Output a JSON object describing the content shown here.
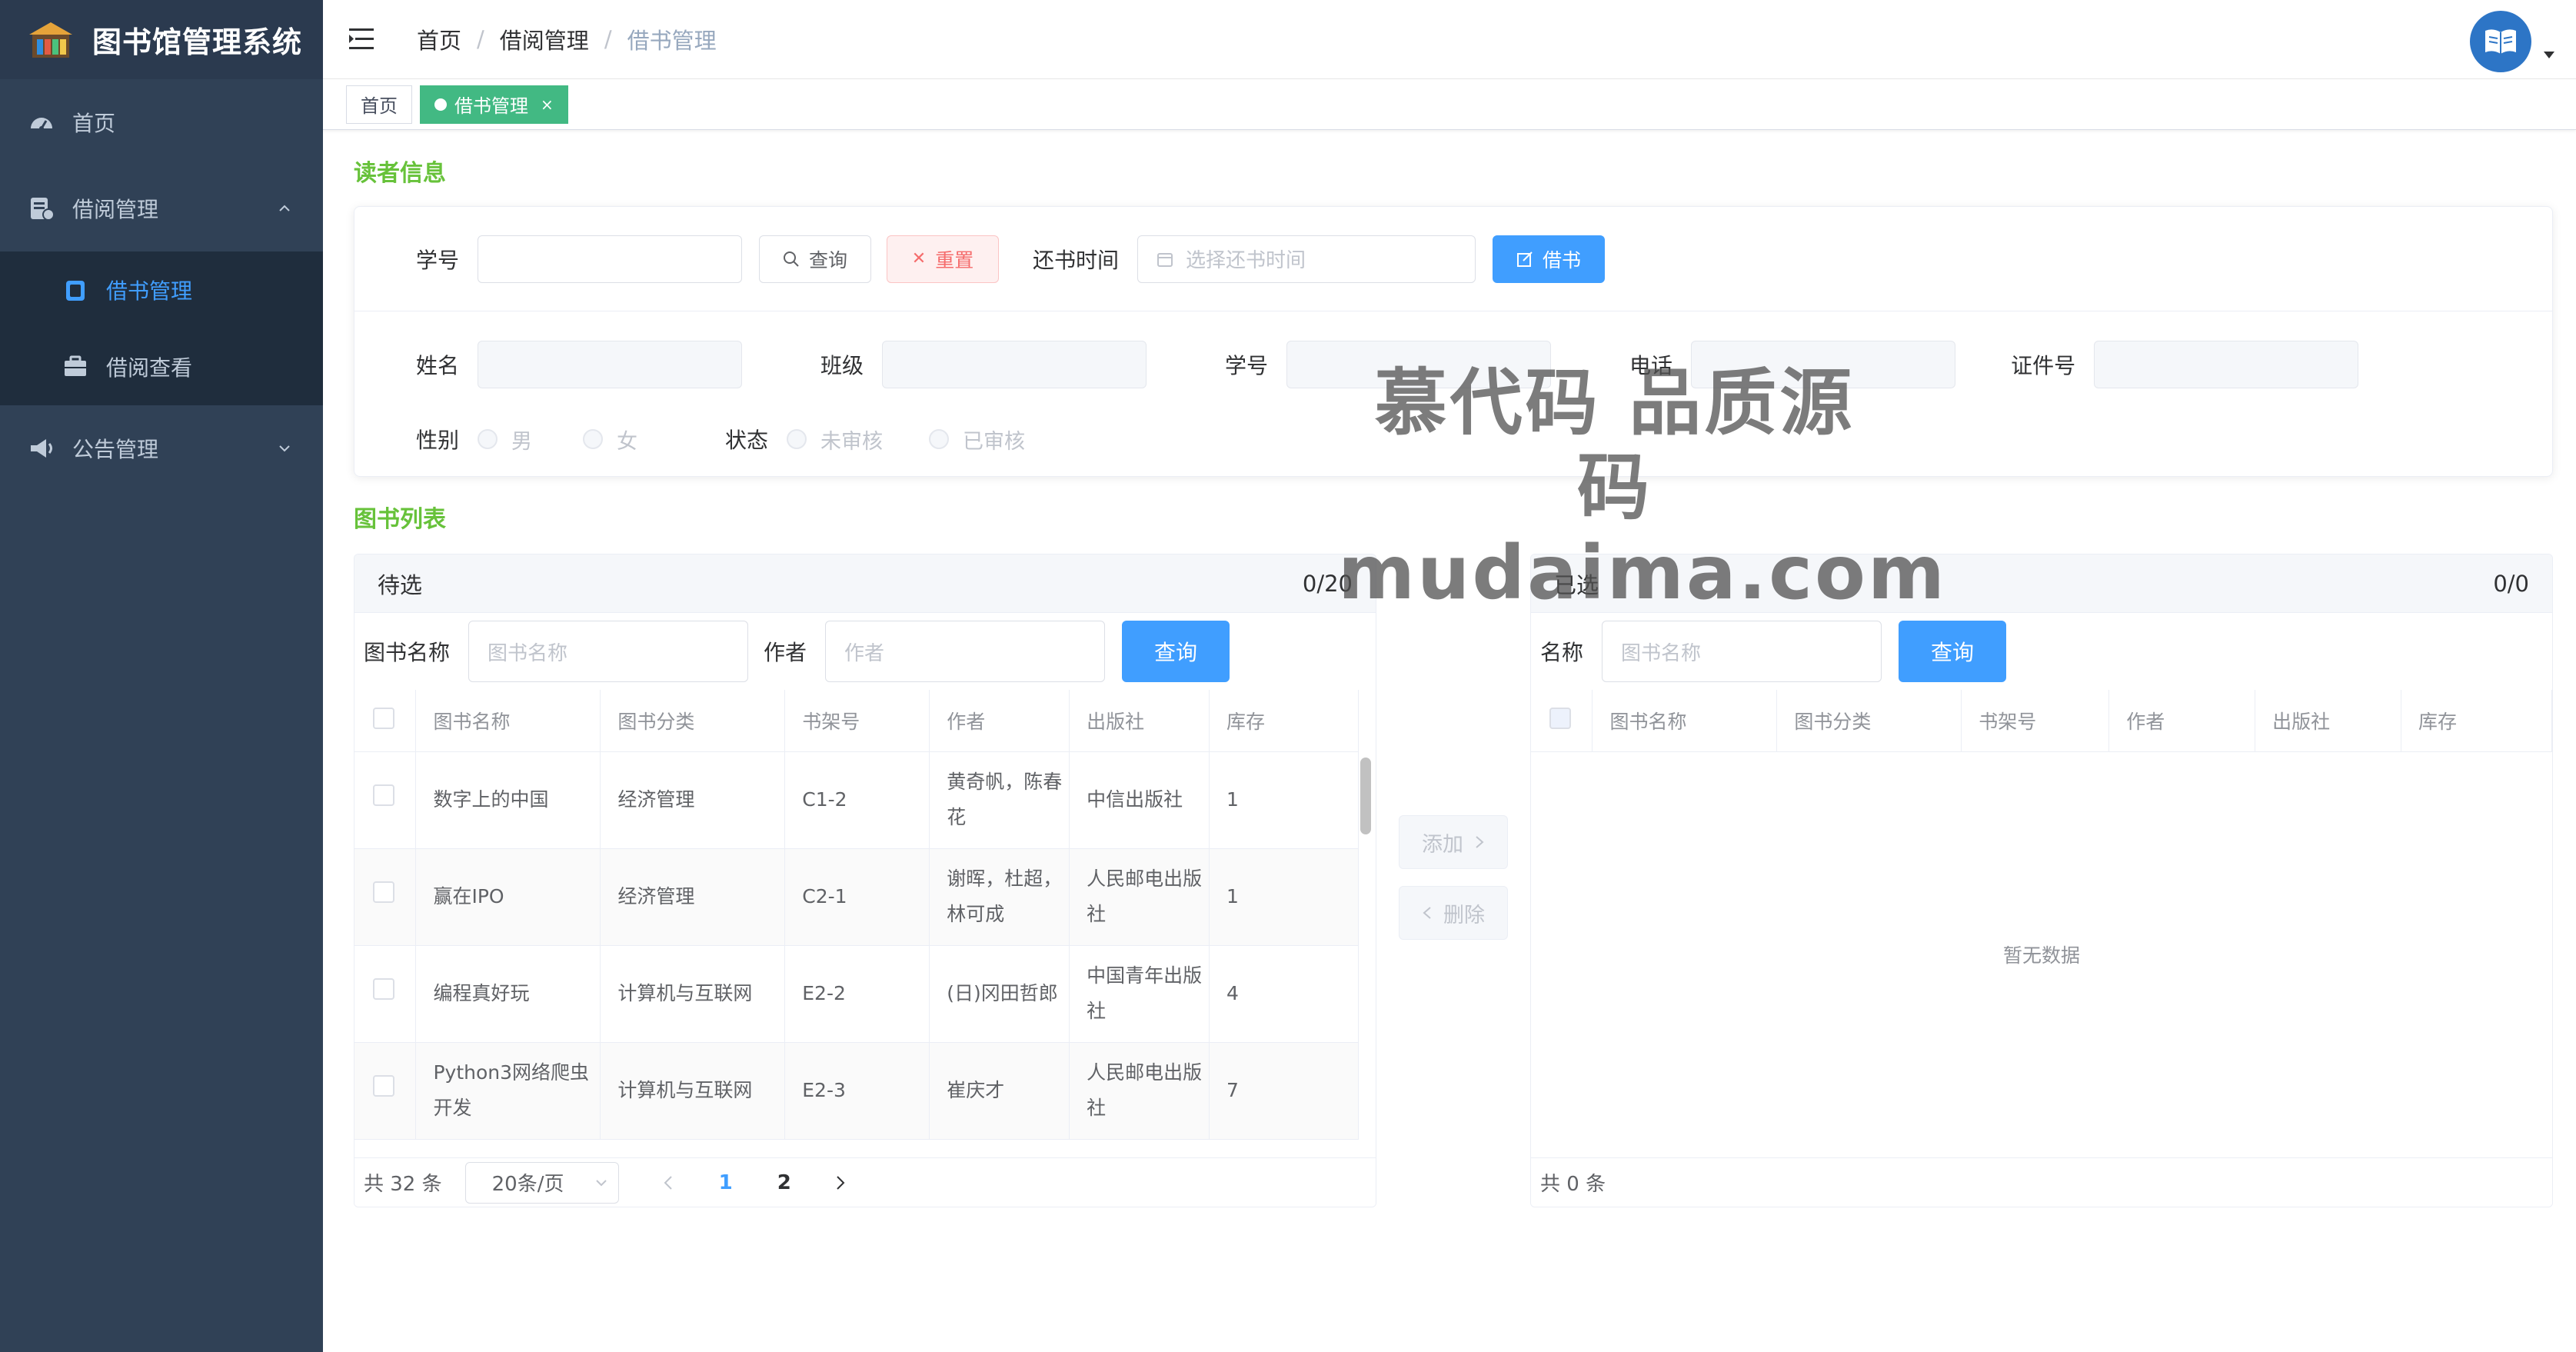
{
  "app": {
    "title": "图书馆管理系统"
  },
  "sidebar": {
    "items": [
      {
        "label": "首页",
        "icon": "dashboard-icon"
      },
      {
        "label": "借阅管理",
        "icon": "borrow-icon"
      },
      {
        "label": "借书管理",
        "icon": "book-icon"
      },
      {
        "label": "借阅查看",
        "icon": "briefcase-icon"
      },
      {
        "label": "公告管理",
        "icon": "megaphone-icon"
      }
    ]
  },
  "header": {
    "breadcrumb": [
      "首页",
      "借阅管理",
      "借书管理"
    ]
  },
  "tags": {
    "home": "首页",
    "active": "借书管理",
    "close": "×"
  },
  "reader": {
    "section_title": "读者信息",
    "student_id_label": "学号",
    "search_btn": "查询",
    "reset_btn": "重置",
    "return_label": "还书时间",
    "return_placeholder": "选择还书时间",
    "borrow_btn": "借书",
    "name_label": "姓名",
    "class_label": "班级",
    "sid_label": "学号",
    "phone_label": "电话",
    "idcard_label": "证件号",
    "gender_label": "性别",
    "male": "男",
    "female": "女",
    "status_label": "状态",
    "unreviewed": "未审核",
    "reviewed": "已审核"
  },
  "books": {
    "section_title": "图书列表",
    "left": {
      "title": "待选",
      "count": "0/20",
      "filter_label": "图书名称",
      "filter_placeholder": "图书名称",
      "author_label": "作者",
      "author_placeholder": "作者",
      "search_btn": "查询",
      "columns": [
        "图书名称",
        "图书分类",
        "书架号",
        "作者",
        "出版社",
        "库存"
      ],
      "rows": [
        [
          "数字上的中国",
          "经济管理",
          "C1-2",
          "黄奇帆，陈春花",
          "中信出版社",
          "1"
        ],
        [
          "赢在IPO",
          "经济管理",
          "C2-1",
          "谢晖，杜超，林可成",
          "人民邮电出版社",
          "1"
        ],
        [
          "编程真好玩",
          "计算机与互联网",
          "E2-2",
          "(日)冈田哲郎",
          "中国青年出版社",
          "4"
        ],
        [
          "Python3网络爬虫开发",
          "计算机与互联网",
          "E2-3",
          "崔庆才",
          "人民邮电出版社",
          "7"
        ]
      ],
      "total": "共 32 条",
      "page_size": "20条/页",
      "pages": [
        "1",
        "2"
      ]
    },
    "add_btn": "添加",
    "delete_btn": "删除",
    "right": {
      "title": "已选",
      "count": "0/0",
      "filter_label": "名称",
      "filter_placeholder": "图书名称",
      "search_btn": "查询",
      "columns": [
        "图书名称",
        "图书分类",
        "书架号",
        "作者",
        "出版社",
        "库存"
      ],
      "empty": "暂无数据",
      "total": "共 0 条"
    }
  },
  "watermark": {
    "line1": "慕代码 品质源码",
    "line2": "mudaima.com"
  },
  "colors": {
    "sidebar": "#304156",
    "primary": "#409eff",
    "success": "#67c23a",
    "tag": "#42b983",
    "danger": "#f56c6c"
  }
}
